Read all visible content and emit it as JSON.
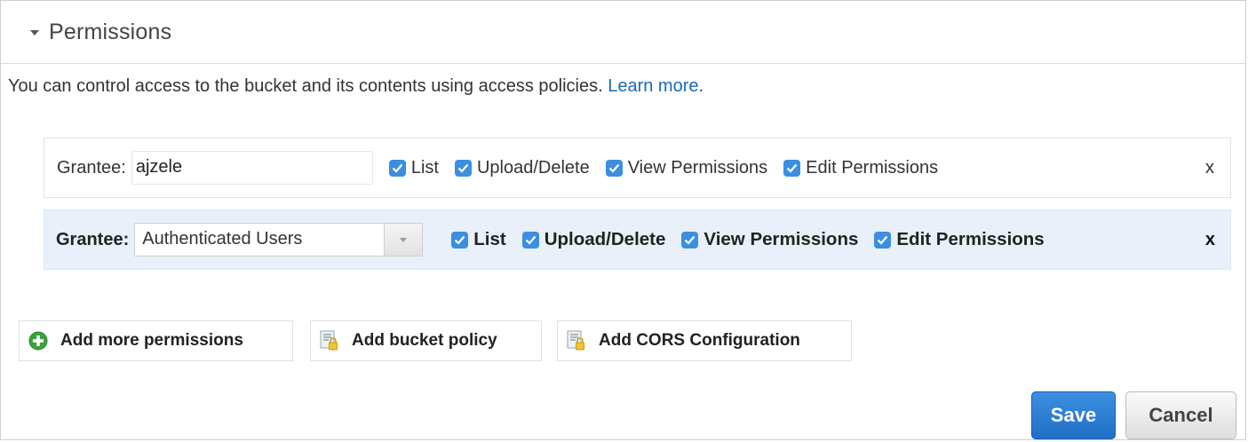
{
  "section": {
    "title": "Permissions",
    "intro_text": "You can control access to the bucket and its contents using access policies. ",
    "learn_more": "Learn more",
    "intro_period": "."
  },
  "grants": [
    {
      "label": "Grantee:",
      "value": "ajzele",
      "permissions": [
        "List",
        "Upload/Delete",
        "View Permissions",
        "Edit Permissions"
      ],
      "remove": "x"
    },
    {
      "label": "Grantee:",
      "value": "Authenticated Users",
      "permissions": [
        "List",
        "Upload/Delete",
        "View Permissions",
        "Edit Permissions"
      ],
      "remove": "x"
    }
  ],
  "actions": {
    "add_permissions": "Add more permissions",
    "add_bucket_policy": "Add bucket policy",
    "add_cors": "Add CORS Configuration"
  },
  "buttons": {
    "save": "Save",
    "cancel": "Cancel"
  },
  "colors": {
    "accent": "#3b8ee0",
    "link": "#1a6ab8",
    "selected_row": "#e9f0fa",
    "add_icon": "#3aa23a"
  },
  "icons": {
    "collapse": "caret-down-icon",
    "checkbox": "checkbox-checked-icon",
    "add": "plus-circle-icon",
    "policy": "policy-document-lock-icon"
  }
}
